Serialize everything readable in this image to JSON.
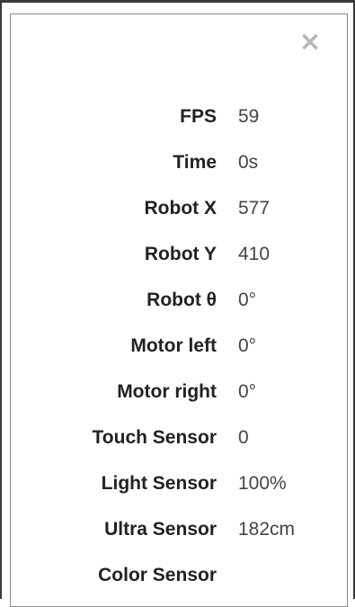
{
  "close": {
    "glyph": "×"
  },
  "stats": [
    {
      "label": "FPS",
      "value": "59"
    },
    {
      "label": "Time",
      "value": "0s"
    },
    {
      "label": "Robot X",
      "value": "577"
    },
    {
      "label": "Robot Y",
      "value": "410"
    },
    {
      "label": "Robot θ",
      "value": "0°"
    },
    {
      "label": "Motor left",
      "value": "0°"
    },
    {
      "label": "Motor right",
      "value": "0°"
    },
    {
      "label": "Touch Sensor",
      "value": "0"
    },
    {
      "label": "Light Sensor",
      "value": "100%"
    },
    {
      "label": "Ultra Sensor",
      "value": "182cm"
    },
    {
      "label": "Color Sensor",
      "value": ""
    }
  ]
}
